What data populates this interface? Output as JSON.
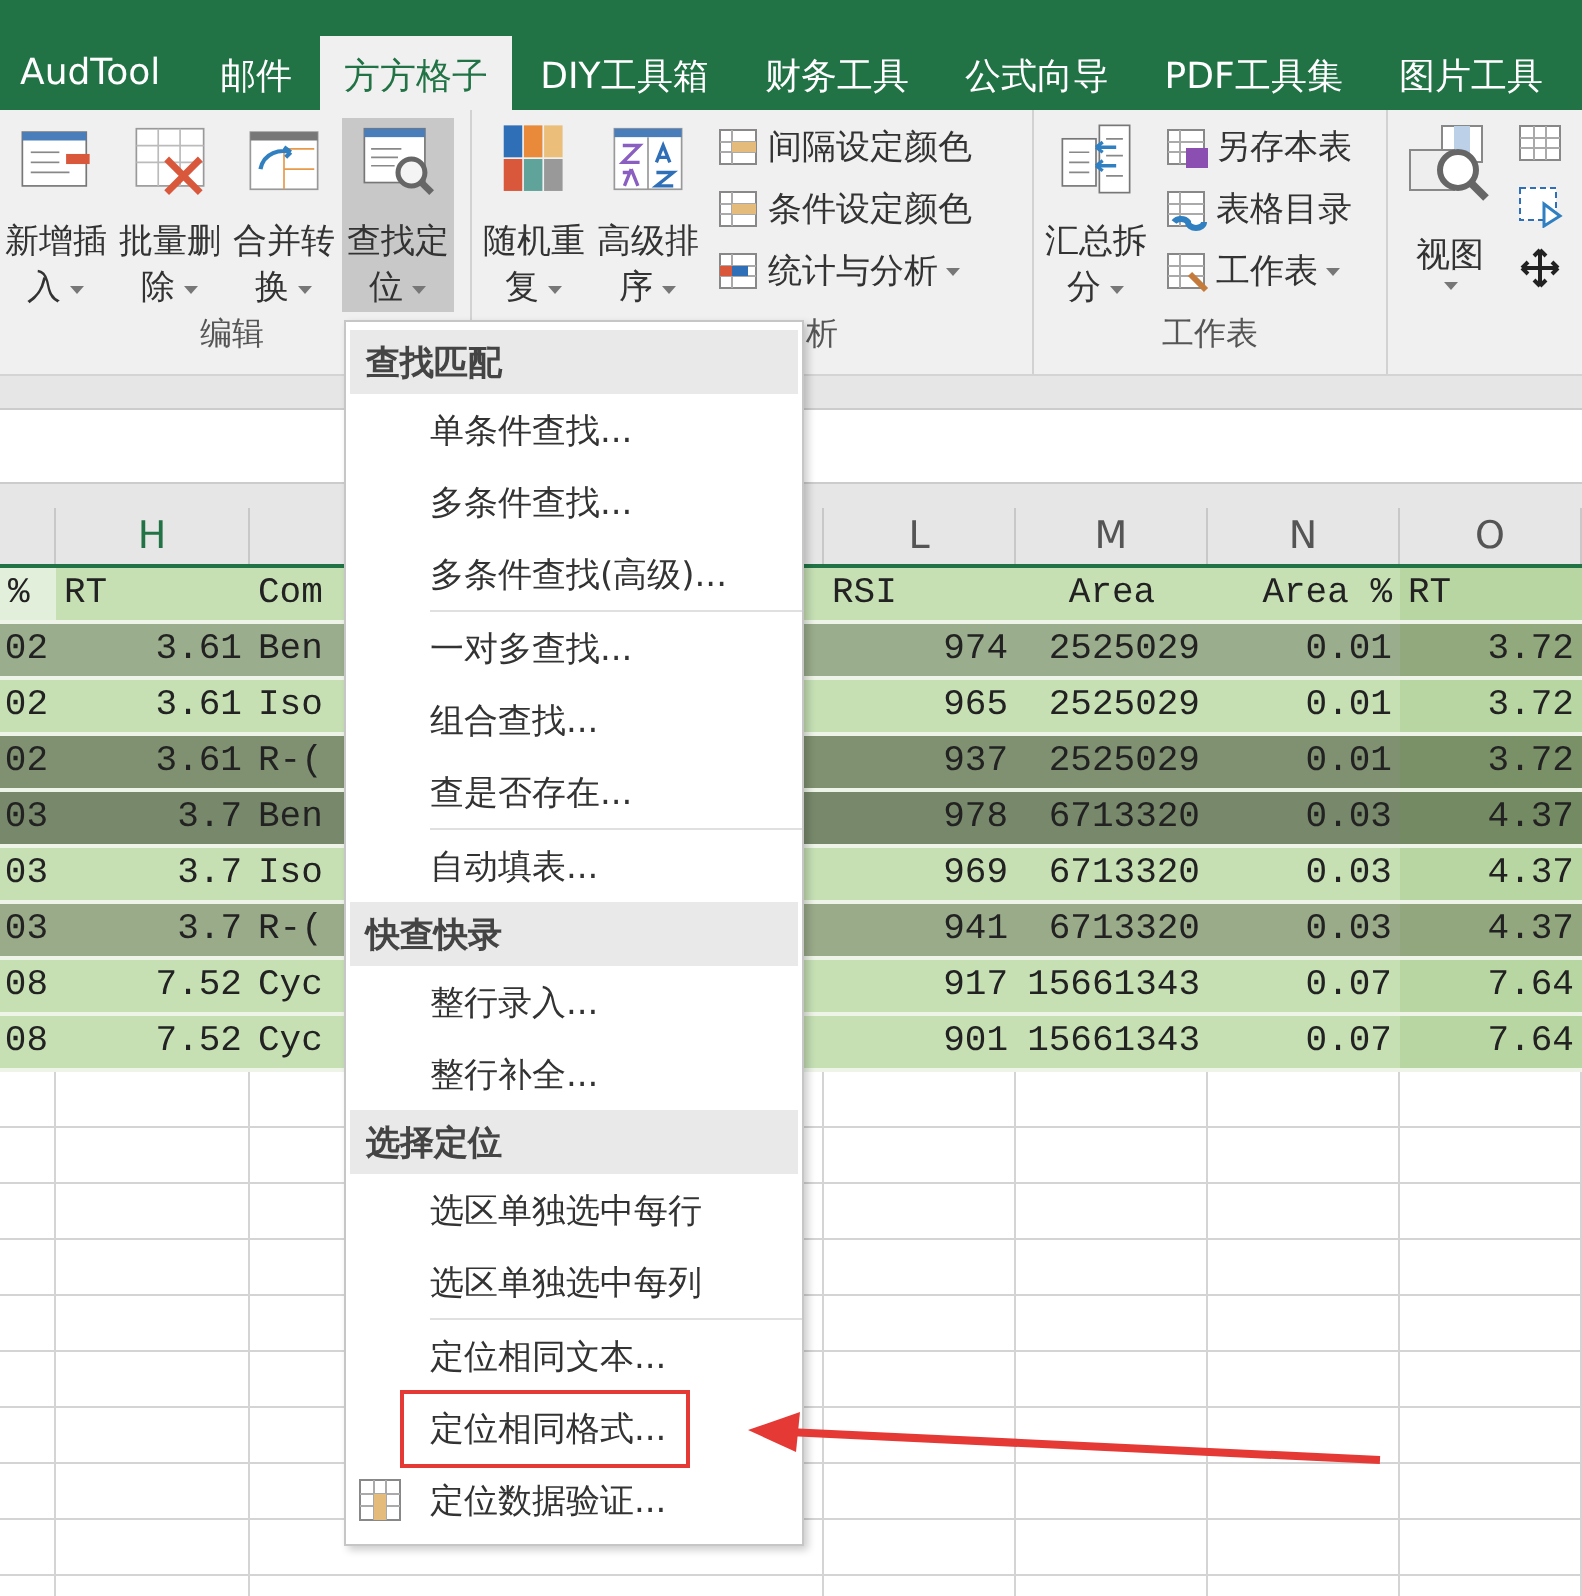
{
  "ribbon_tabs": [
    {
      "label": "AudTool",
      "selected": false
    },
    {
      "label": "邮件",
      "selected": false
    },
    {
      "label": "方方格子",
      "selected": true
    },
    {
      "label": "DIY工具箱",
      "selected": false
    },
    {
      "label": "财务工具",
      "selected": false
    },
    {
      "label": "公式向导",
      "selected": false
    },
    {
      "label": "PDF工具集",
      "selected": false
    },
    {
      "label": "图片工具",
      "selected": false
    }
  ],
  "ribbon_groups": [
    {
      "label": "编辑",
      "controls": [
        {
          "kind": "large",
          "lines": [
            "新增插",
            "入"
          ],
          "has_menu": true,
          "pressed": false
        },
        {
          "kind": "large",
          "lines": [
            "批量删",
            "除"
          ],
          "has_menu": true,
          "pressed": false
        },
        {
          "kind": "large",
          "lines": [
            "合并转",
            "换"
          ],
          "has_menu": true,
          "pressed": false
        },
        {
          "kind": "large",
          "lines": [
            "查找定",
            "位"
          ],
          "has_menu": true,
          "pressed": true
        }
      ]
    },
    {
      "label": "析",
      "controls": [
        {
          "kind": "large",
          "lines": [
            "随机重",
            "复"
          ],
          "has_menu": true,
          "pressed": false
        },
        {
          "kind": "large",
          "lines": [
            "高级排",
            "序"
          ],
          "has_menu": true,
          "pressed": false
        },
        {
          "kind": "small",
          "items": [
            {
              "label": "间隔设定颜色",
              "has_menu": false
            },
            {
              "label": "条件设定颜色",
              "has_menu": false
            },
            {
              "label": "统计与分析",
              "has_menu": true
            }
          ]
        }
      ]
    },
    {
      "label": "工作表",
      "controls": [
        {
          "kind": "large",
          "lines": [
            "汇总拆",
            "分"
          ],
          "has_menu": true,
          "pressed": false
        },
        {
          "kind": "small",
          "items": [
            {
              "label": "另存本表",
              "has_menu": false
            },
            {
              "label": "表格目录",
              "has_menu": false
            },
            {
              "label": "工作表",
              "has_menu": true
            }
          ]
        }
      ]
    },
    {
      "controls": [
        {
          "kind": "large",
          "lines": [
            "视图"
          ],
          "has_menu": true,
          "pressed": false
        },
        {
          "kind": "icons"
        }
      ]
    }
  ],
  "grid": {
    "column_headers": [
      {
        "letter": "H",
        "selected": true
      },
      {
        "letter": "L",
        "selected": false
      },
      {
        "letter": "M",
        "selected": false
      },
      {
        "letter": "N",
        "selected": false
      },
      {
        "letter": "O",
        "selected": false
      }
    ],
    "header_row": {
      "color": "#c6e0b4",
      "cells": [
        "%",
        "RT",
        "Com",
        "RSI",
        "Area",
        "Area %",
        "RT"
      ]
    },
    "rows": [
      {
        "color": "#9aad8c",
        "cells": [
          "02",
          "3.61",
          "Ben",
          "974",
          "2525029",
          "0.01",
          "3.72"
        ]
      },
      {
        "color": "#c6e0b4",
        "cells": [
          "02",
          "3.61",
          "Iso",
          "965",
          "2525029",
          "0.01",
          "3.72"
        ]
      },
      {
        "color": "#7f9171",
        "cells": [
          "02",
          "3.61",
          "R-(",
          "937",
          "2525029",
          "0.01",
          "3.72"
        ]
      },
      {
        "color": "#78896b",
        "cells": [
          "03",
          "3.7",
          "Ben",
          "978",
          "6713320",
          "0.03",
          "4.37"
        ]
      },
      {
        "color": "#c6e0b4",
        "cells": [
          "03",
          "3.7",
          "Iso",
          "969",
          "6713320",
          "0.03",
          "4.37"
        ]
      },
      {
        "color": "#9aab8a",
        "cells": [
          "03",
          "3.7",
          "R-(",
          "941",
          "6713320",
          "0.03",
          "4.37"
        ]
      },
      {
        "color": "#c6e0b4",
        "cells": [
          "08",
          "7.52",
          "Cyc",
          "917",
          "15661343",
          "0.07",
          "7.64"
        ]
      },
      {
        "color": "#c6e0b4",
        "cells": [
          "08",
          "7.52",
          "Cyc",
          "901",
          "15661343",
          "0.07",
          "7.64"
        ]
      }
    ]
  },
  "dropdown_menu": {
    "sections": [
      {
        "title": "查找匹配",
        "groups": [
          [
            {
              "label": "单条件查找...",
              "has_icon": false,
              "highlighted": false
            },
            {
              "label": "多条件查找...",
              "has_icon": false,
              "highlighted": false
            },
            {
              "label": "多条件查找(高级)...",
              "has_icon": false,
              "highlighted": false
            }
          ],
          [
            {
              "label": "一对多查找...",
              "has_icon": false,
              "highlighted": false
            },
            {
              "label": "组合查找...",
              "has_icon": false,
              "highlighted": false
            },
            {
              "label": "查是否存在...",
              "has_icon": false,
              "highlighted": false
            }
          ],
          [
            {
              "label": "自动填表...",
              "has_icon": false,
              "highlighted": false
            }
          ]
        ]
      },
      {
        "title": "快查快录",
        "groups": [
          [
            {
              "label": "整行录入...",
              "has_icon": false,
              "highlighted": false
            },
            {
              "label": "整行补全...",
              "has_icon": false,
              "highlighted": false
            }
          ]
        ]
      },
      {
        "title": "选择定位",
        "groups": [
          [
            {
              "label": "选区单独选中每行",
              "has_icon": false,
              "highlighted": false
            },
            {
              "label": "选区单独选中每列",
              "has_icon": false,
              "highlighted": false
            }
          ],
          [
            {
              "label": "定位相同文本...",
              "has_icon": false,
              "highlighted": false
            },
            {
              "label": "定位相同格式...",
              "has_icon": false,
              "highlighted": true
            },
            {
              "label": "定位数据验证...",
              "has_icon": true,
              "highlighted": false
            }
          ]
        ]
      }
    ]
  }
}
